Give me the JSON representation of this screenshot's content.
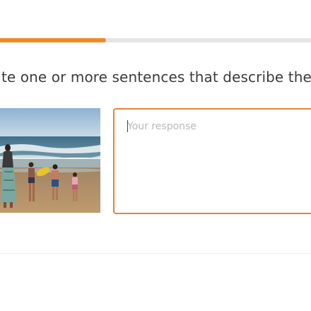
{
  "progress": {
    "fraction": 0.34,
    "fill_color": "#f08a24"
  },
  "prompt": {
    "text": "rite one or more sentences that describe the i"
  },
  "image": {
    "icon": "beach-photo-icon"
  },
  "response": {
    "placeholder": "Your response",
    "value": "",
    "border_color": "#e8823a"
  }
}
